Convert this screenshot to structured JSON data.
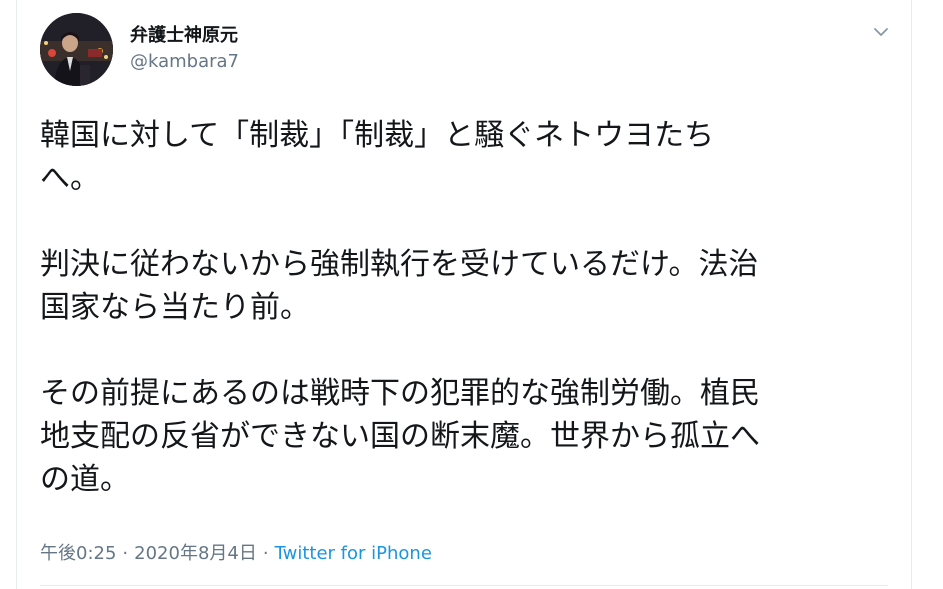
{
  "user": {
    "display_name": "弁護士神原元",
    "handle": "@kambara7"
  },
  "tweet": {
    "paragraphs": [
      "韓国に対して「制裁」「制裁」と騒ぐネトウヨたち\nへ。",
      "判決に従わないから強制執行を受けているだけ。法治\n国家なら当たり前。",
      "その前提にあるのは戦時下の犯罪的な強制労働。植民\n地支配の反省ができない国の断末魔。世界から孤立へ\nの道。"
    ],
    "time": "午後0:25",
    "date": "2020年8月4日",
    "separator": "·",
    "source": "Twitter for iPhone"
  },
  "icons": {
    "caret": "chevron-down-icon"
  },
  "colors": {
    "text": "#14171a",
    "secondary": "#657786",
    "link": "#1b95e0",
    "border": "#e6ecf0"
  }
}
